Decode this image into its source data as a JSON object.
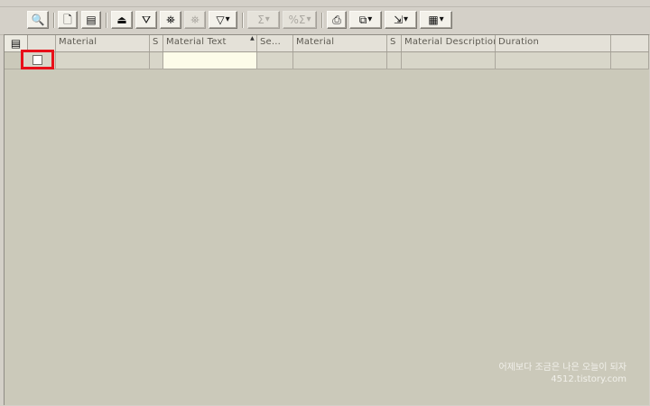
{
  "toolbar": {
    "buttons": [
      {
        "icon": "details-magnifier-icon",
        "enabled": true
      },
      {
        "icon": "create-document-icon",
        "enabled": true
      },
      {
        "icon": "change-document-icon",
        "enabled": true
      },
      {
        "icon": "sort-ascending-icon",
        "enabled": true
      },
      {
        "icon": "sort-descending-icon",
        "enabled": true
      },
      {
        "icon": "find-binoculars-icon",
        "enabled": true
      },
      {
        "icon": "find-next-icon",
        "enabled": false
      },
      {
        "icon": "filter-icon",
        "enabled": true
      },
      {
        "icon": "total-sum-icon",
        "enabled": false
      },
      {
        "icon": "subtotal-icon",
        "enabled": false
      },
      {
        "icon": "print-preview-icon",
        "enabled": true
      },
      {
        "icon": "views-icon",
        "enabled": true
      },
      {
        "icon": "export-icon",
        "enabled": true
      },
      {
        "icon": "choose-layout-icon",
        "enabled": true
      }
    ]
  },
  "table": {
    "columns": [
      {
        "label": "Material"
      },
      {
        "label": "S"
      },
      {
        "label": "Material Text"
      },
      {
        "label": "Se..."
      },
      {
        "label": "Material"
      },
      {
        "label": "S"
      },
      {
        "label": "Material Description"
      },
      {
        "label": "Duration"
      },
      {
        "label": ""
      }
    ],
    "rows": [
      {
        "checked": false,
        "cells": [
          "",
          "",
          "",
          "",
          "",
          "",
          "",
          "",
          ""
        ]
      }
    ]
  },
  "watermark": {
    "line1": "어제보다 조금은 나은 오늘이 되자",
    "line2": "4512.tistory.com"
  },
  "colors": {
    "highlight": "#e8101a",
    "grid_background": "#cbc9ba",
    "editable_cell": "#fdfce9"
  }
}
